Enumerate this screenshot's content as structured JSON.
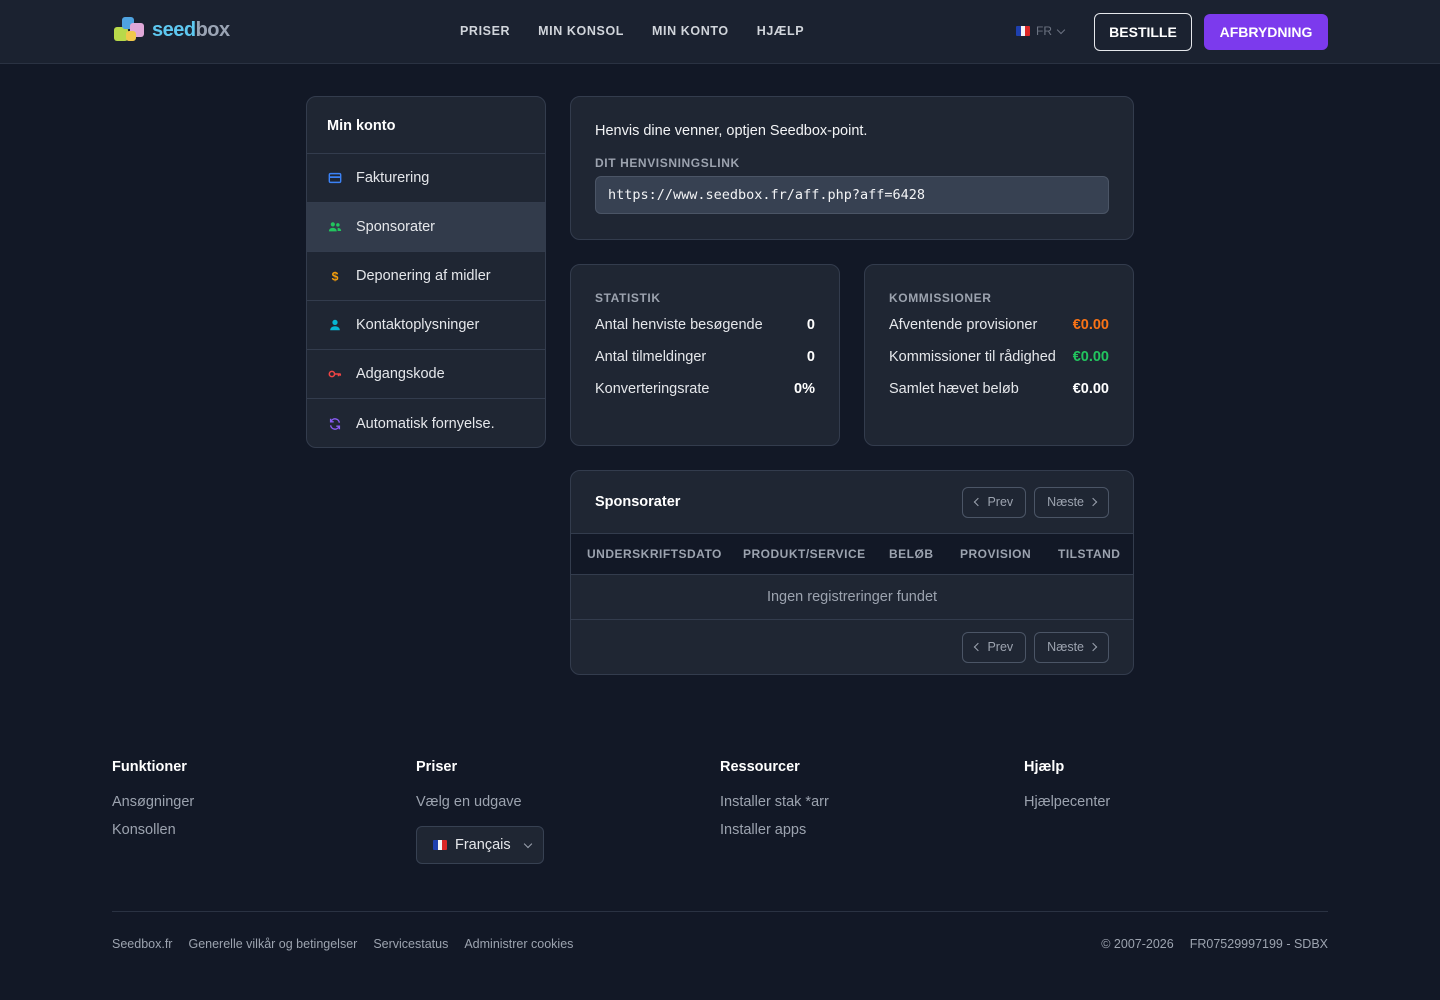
{
  "header": {
    "logo_text_1": "seed",
    "logo_text_2": "box",
    "nav": [
      "PRISER",
      "MIN KONSOL",
      "MIN KONTO",
      "HJÆLP"
    ],
    "language": "FR",
    "order_label": "BESTILLE",
    "logout_label": "AFBRYDNING",
    "accent_color": "#7c3aed"
  },
  "sidebar": {
    "title": "Min konto",
    "items": [
      {
        "label": "Fakturering",
        "icon": "credit-card-icon",
        "color": "#3b82f6"
      },
      {
        "label": "Sponsorater",
        "icon": "users-icon",
        "color": "#22c55e",
        "active": true
      },
      {
        "label": "Deponering af midler",
        "icon": "dollar-icon",
        "color": "#f59e0b"
      },
      {
        "label": "Kontaktoplysninger",
        "icon": "user-icon",
        "color": "#06b6d4"
      },
      {
        "label": "Adgangskode",
        "icon": "key-icon",
        "color": "#ef4444"
      },
      {
        "label": "Automatisk fornyelse.",
        "icon": "refresh-icon",
        "color": "#8b5cf6"
      }
    ]
  },
  "referral": {
    "intro": "Henvis dine venner, optjen Seedbox-point.",
    "link_label": "DIT HENVISNINGSLINK",
    "link_value": "https://www.seedbox.fr/aff.php?aff=6428"
  },
  "stats": {
    "title": "STATISTIK",
    "rows": [
      {
        "label": "Antal henviste besøgende",
        "value": "0"
      },
      {
        "label": "Antal tilmeldinger",
        "value": "0"
      },
      {
        "label": "Konverteringsrate",
        "value": "0%"
      }
    ]
  },
  "commissions": {
    "title": "KOMMISSIONER",
    "rows": [
      {
        "label": "Afventende provisioner",
        "value": "€0.00",
        "color": "#f97316"
      },
      {
        "label": "Kommissioner til rådighed",
        "value": "€0.00",
        "color": "#22c55e"
      },
      {
        "label": "Samlet hævet beløb",
        "value": "€0.00",
        "color": "#ffffff"
      }
    ]
  },
  "sponsor_table": {
    "title": "Sponsorater",
    "prev_label": "Prev",
    "next_label": "Næste",
    "columns": [
      "UNDERSKRIFTSDATO",
      "PRODUKT/SERVICE",
      "BELØB",
      "PROVISION",
      "TILSTAND"
    ],
    "empty_text": "Ingen registreringer fundet"
  },
  "footer": {
    "cols": [
      {
        "title": "Funktioner",
        "links": [
          "Ansøgninger",
          "Konsollen"
        ]
      },
      {
        "title": "Priser",
        "links": [
          "Vælg en udgave"
        ]
      },
      {
        "title": "Ressourcer",
        "links": [
          "Installer stak *arr",
          "Installer apps"
        ]
      },
      {
        "title": "Hjælp",
        "links": [
          "Hjælpecenter"
        ]
      }
    ],
    "language_select": "Français",
    "bottom_links": [
      "Seedbox.fr",
      "Generelle vilkår og betingelser",
      "Servicestatus",
      "Administrer cookies"
    ],
    "copyright": "© 2007-2026",
    "company_id": "FR07529997199 - SDBX"
  }
}
